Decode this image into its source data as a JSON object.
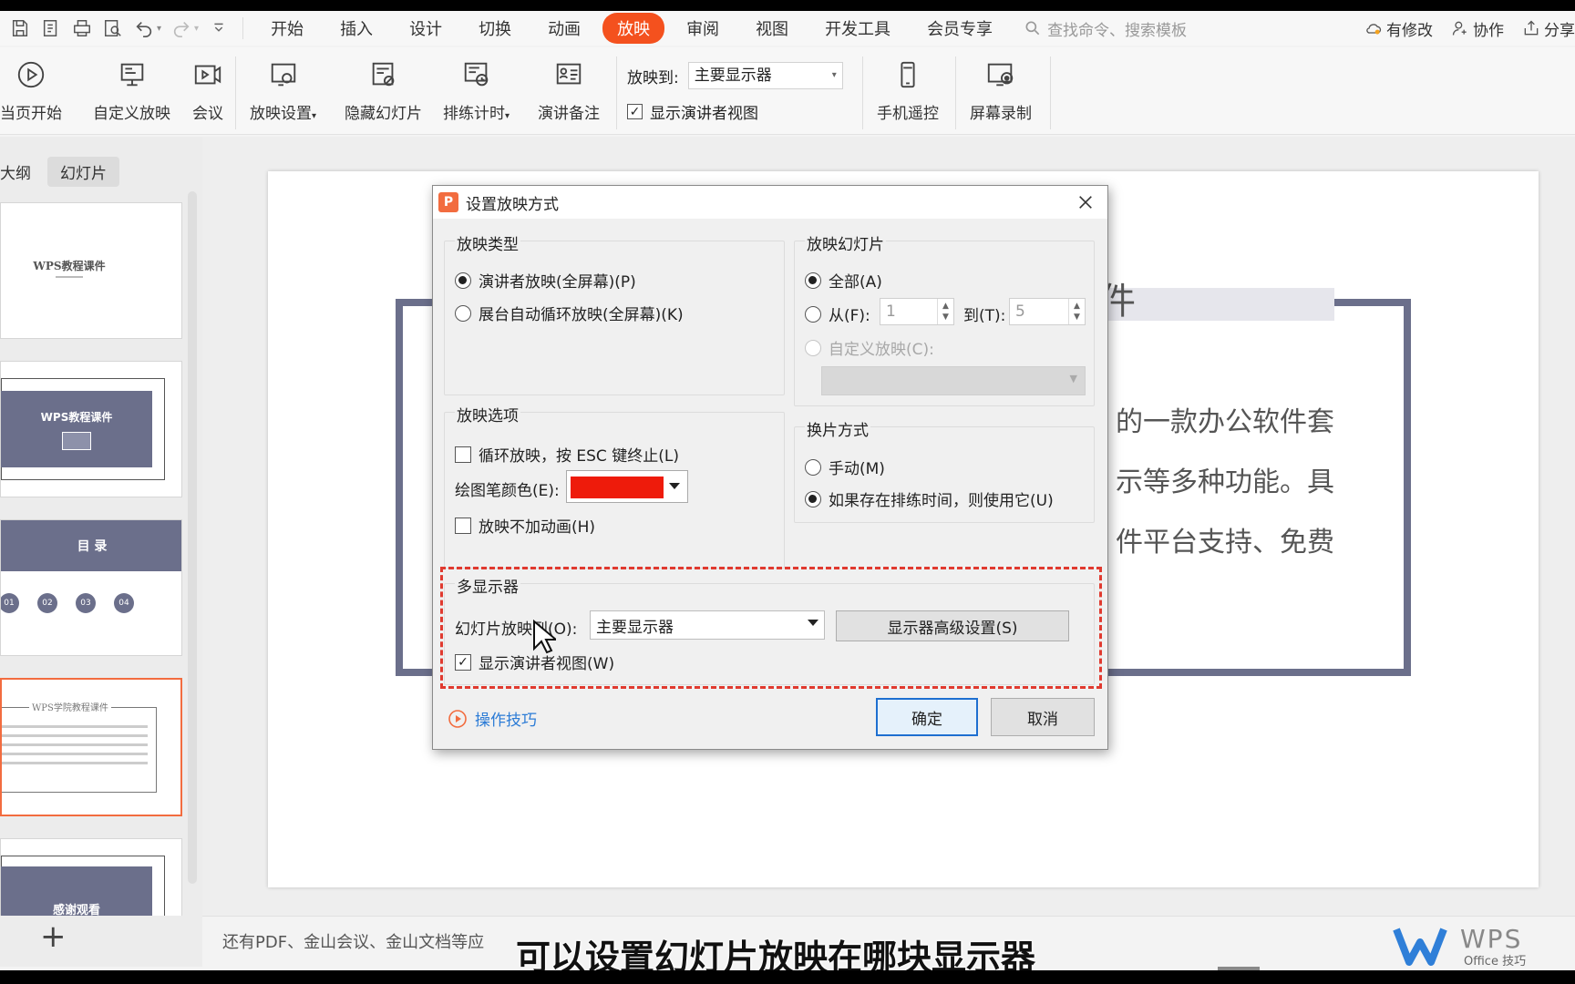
{
  "menu": {
    "tabs": [
      "开始",
      "插入",
      "设计",
      "切换",
      "动画",
      "放映",
      "审阅",
      "视图",
      "开发工具",
      "会员专享"
    ],
    "active_tab": "放映",
    "search_placeholder": "查找命令、搜索模板",
    "right": {
      "modified": "有修改",
      "collab": "协作",
      "share": "分享"
    }
  },
  "ribbon": {
    "from_current": "当页开始",
    "custom_show": "自定义放映",
    "meeting": "会议",
    "show_settings": "放映设置",
    "hide_slide": "隐藏幻灯片",
    "rehearse": "排练计时",
    "speaker_notes": "演讲备注",
    "show_to_label": "放映到:",
    "show_to_value": "主要显示器",
    "presenter_view": "显示演讲者视图",
    "phone_remote": "手机遥控",
    "screen_record": "屏幕录制"
  },
  "left_panel": {
    "tab_outline": "大纲",
    "tab_slides": "幻灯片",
    "thumb1_title": "WPS教程课件",
    "thumb2_title": "WPS教程课件",
    "thumb3_title": "目  录",
    "thumb3_nums": [
      "01",
      "02",
      "03",
      "04"
    ],
    "thumb4_title": "WPS学院教程课件",
    "thumb5_title": "感谢观看"
  },
  "slide": {
    "title_fragment": "件",
    "line1": "的一款办公软件套",
    "line2": "示等多种功能。具",
    "line3": "件平台支持、免费"
  },
  "bottom": {
    "note": "还有PDF、金山会议、金山文档等应",
    "subtitle": "可以设置幻灯片放映在哪块显示器",
    "brand": "WPS",
    "brand_sub": "Office 技巧"
  },
  "dialog": {
    "title": "设置放映方式",
    "show_type": {
      "label": "放映类型",
      "opt1": "演讲者放映(全屏幕)(P)",
      "opt2": "展台自动循环放映(全屏幕)(K)"
    },
    "show_slides": {
      "label": "放映幻灯片",
      "all": "全部(A)",
      "from": "从(F):",
      "from_value": "1",
      "to": "到(T):",
      "to_value": "5",
      "custom": "自定义放映(C):"
    },
    "show_options": {
      "label": "放映选项",
      "loop": "循环放映，按 ESC 键终止(L)",
      "pen_color": "绘图笔颜色(E):",
      "pen_color_hex": "#ee1b0b",
      "no_animation": "放映不加动画(H)"
    },
    "advance": {
      "label": "换片方式",
      "manual": "手动(M)",
      "timing": "如果存在排练时间，则使用它(U)"
    },
    "multi_monitor": {
      "label": "多显示器",
      "show_on": "幻灯片放映到(O):",
      "monitor_value": "主要显示器",
      "advanced_button": "显示器高级设置(S)",
      "presenter_view": "显示演讲者视图(W)"
    },
    "tips": "操作技巧",
    "ok": "确定",
    "cancel": "取消"
  },
  "colors": {
    "accent": "#f4511e",
    "slide_band": "#6b6f8b",
    "highlight": "#e03a2f",
    "link": "#2b7bd6"
  }
}
